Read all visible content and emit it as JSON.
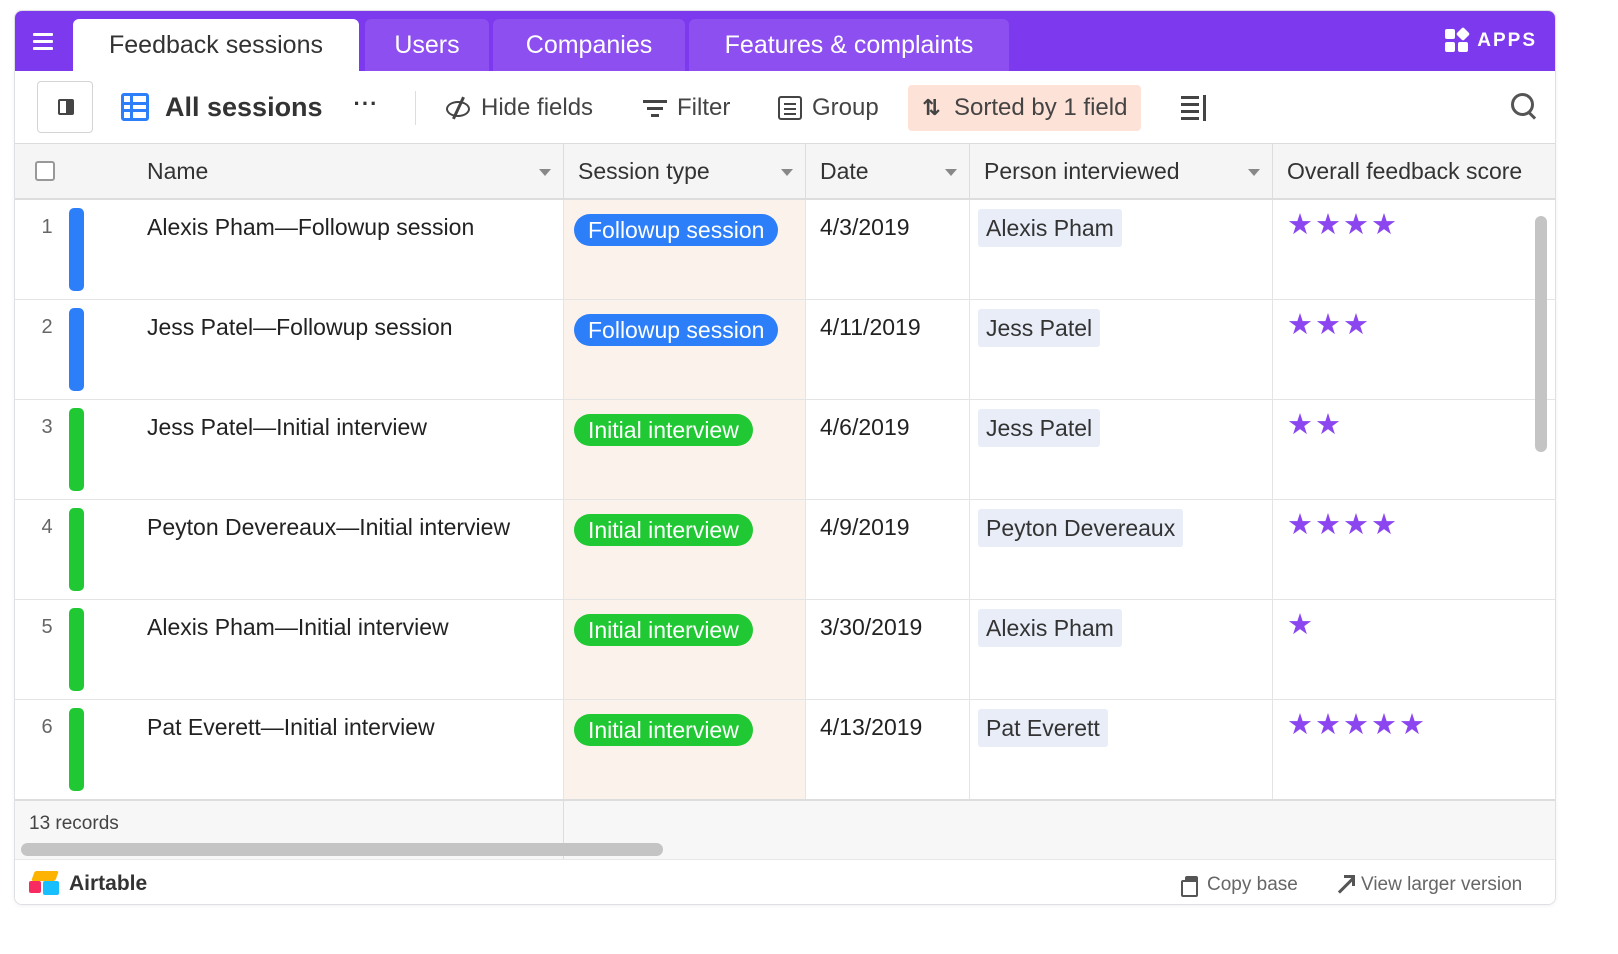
{
  "tabs": [
    {
      "label": "Feedback sessions",
      "active": true
    },
    {
      "label": "Users",
      "active": false
    },
    {
      "label": "Companies",
      "active": false
    },
    {
      "label": "Features & complaints",
      "active": false
    }
  ],
  "apps_label": "APPS",
  "colors": {
    "brand_purple": "#7c39ed",
    "followup_pill": "#2d7ff9",
    "initial_pill": "#20c933",
    "star": "#8b46f0",
    "sorted_bg": "#fde2d7"
  },
  "toolbar": {
    "view_name": "All sessions",
    "more_label": "···",
    "hide_fields": "Hide fields",
    "filter": "Filter",
    "group": "Group",
    "sort": "Sorted by 1 field"
  },
  "columns": {
    "name": "Name",
    "session_type": "Session type",
    "date": "Date",
    "person": "Person interviewed",
    "score": "Overall feedback score"
  },
  "rows": [
    {
      "num": "1",
      "name": "Alexis Pham—Followup session",
      "type": "Followup session",
      "type_kind": "followup",
      "date": "4/3/2019",
      "person": "Alexis Pham",
      "score": 4
    },
    {
      "num": "2",
      "name": "Jess Patel—Followup session",
      "type": "Followup session",
      "type_kind": "followup",
      "date": "4/11/2019",
      "person": "Jess Patel",
      "score": 3
    },
    {
      "num": "3",
      "name": "Jess Patel—Initial interview",
      "type": "Initial interview",
      "type_kind": "initial",
      "date": "4/6/2019",
      "person": "Jess Patel",
      "score": 2
    },
    {
      "num": "4",
      "name": "Peyton Devereaux—Initial interview",
      "type": "Initial interview",
      "type_kind": "initial",
      "date": "4/9/2019",
      "person": "Peyton Devereaux",
      "score": 4
    },
    {
      "num": "5",
      "name": "Alexis Pham—Initial interview",
      "type": "Initial interview",
      "type_kind": "initial",
      "date": "3/30/2019",
      "person": "Alexis Pham",
      "score": 1
    },
    {
      "num": "6",
      "name": "Pat Everett—Initial interview",
      "type": "Initial interview",
      "type_kind": "initial",
      "date": "4/13/2019",
      "person": "Pat Everett",
      "score": 5
    }
  ],
  "footer": {
    "records": "13 records",
    "brand": "Airtable",
    "copy_base": "Copy base",
    "view_larger": "View larger version"
  }
}
